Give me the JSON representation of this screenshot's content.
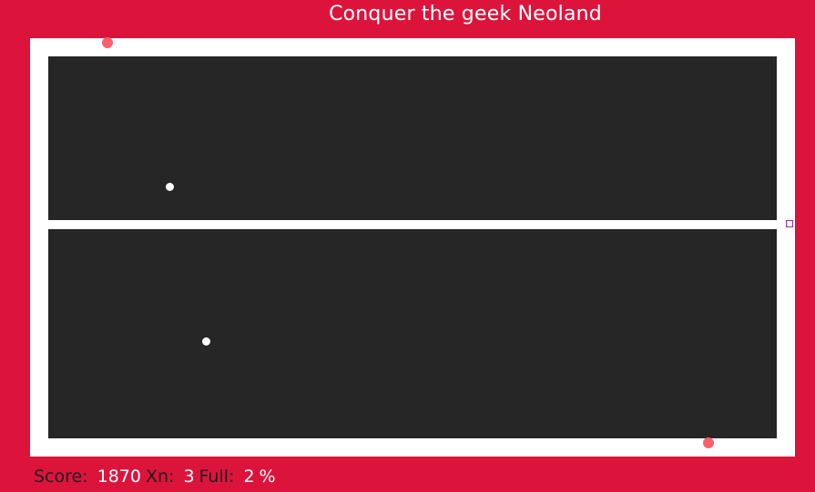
{
  "game": {
    "title": "Conquer the geek Neoland"
  },
  "status": {
    "score_label": "Score:",
    "score_value": "1870",
    "lives_label": "Xn:",
    "lives_value": "3",
    "fill_label": "Full:",
    "fill_value": "2",
    "fill_unit": "%"
  },
  "colors": {
    "background": "#dc143c",
    "board_border": "#ffffff",
    "unclaimed_area": "#262626",
    "enemy": "#ff5f6b",
    "ball": "#ffffff",
    "player_outline": "#9b27a6"
  }
}
